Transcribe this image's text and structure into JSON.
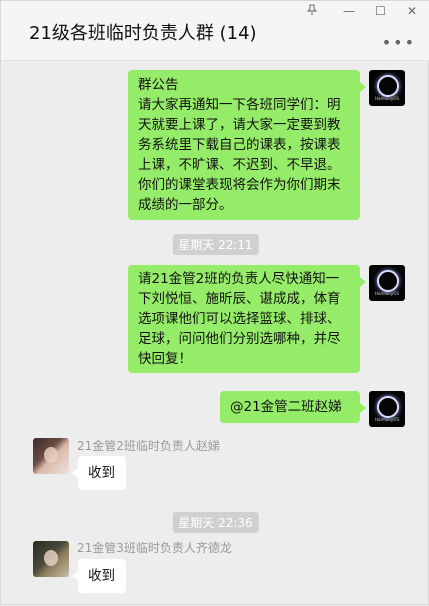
{
  "header": {
    "title": "21级各班临时负责人群 (14)",
    "pin_icon": "pin-icon",
    "min_label": "—",
    "max_label": "☐",
    "close_label": "✕",
    "more_label": "•••"
  },
  "messages": [
    {
      "type": "outgoing",
      "text_lines": [
        "群公告",
        "请大家再通知一下各班同学们：明",
        "天就要上课了，请大家一定要到教",
        "务系统里下载自己的课表，按课表",
        "上课，不旷课、不迟到、不早退。",
        "你们的课堂表现将会作为你们期末",
        "成绩的一部分。"
      ],
      "avatar_label": "HarmonyOS"
    },
    {
      "type": "time",
      "text": "星期天 22:11"
    },
    {
      "type": "outgoing",
      "text_lines": [
        "请21金管2班的负责人尽快通知一",
        "下刘悦恒、施昕辰、谌成成，体育",
        "选项课他们可以选择篮球、排球、",
        "足球，问问他们分别选哪种，并尽",
        "快回复！"
      ],
      "avatar_label": "HarmonyOS"
    },
    {
      "type": "outgoing",
      "text": "@21金管二班赵娣",
      "avatar_label": "HarmonyOS"
    },
    {
      "type": "incoming",
      "sender": "21金管2班临时负责人赵娣",
      "text": "收到"
    },
    {
      "type": "time",
      "text": "星期天 22:36"
    },
    {
      "type": "incoming",
      "sender": "21金管3班临时负责人齐德龙",
      "text": "收到"
    }
  ]
}
